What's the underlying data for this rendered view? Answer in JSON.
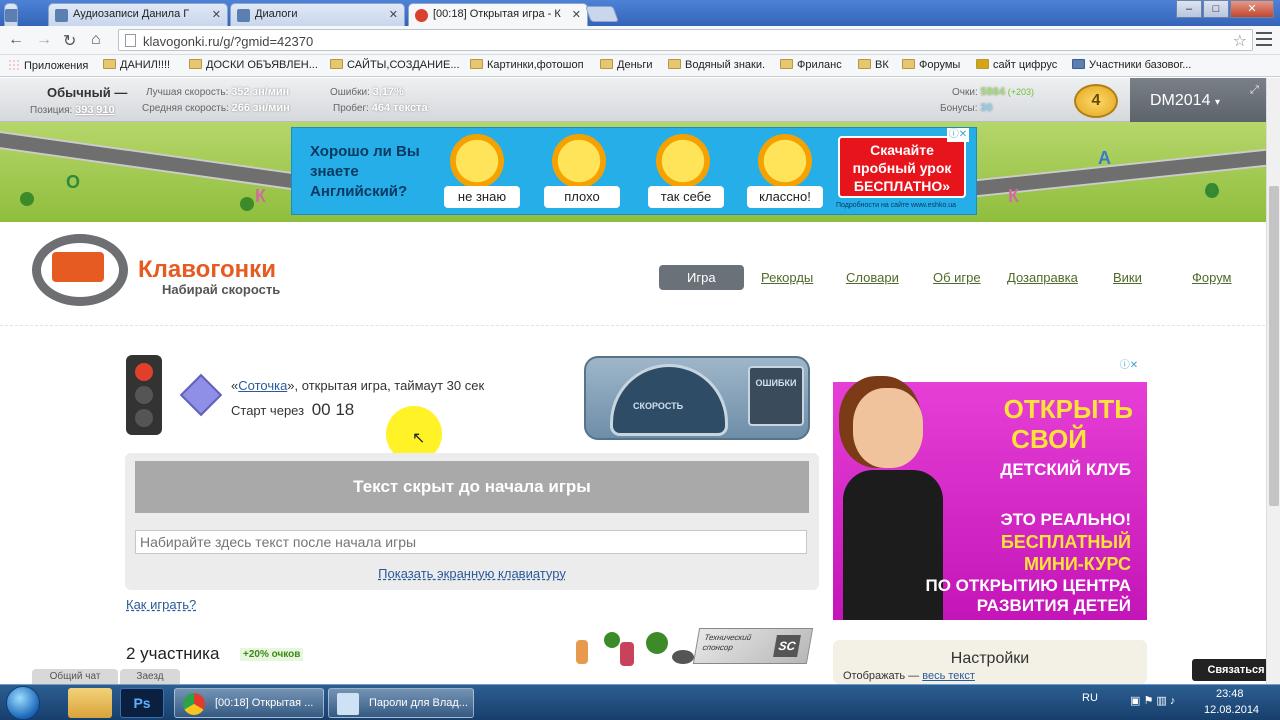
{
  "browser": {
    "tabs": [
      {
        "title": "Аудиозаписи Данила Г"
      },
      {
        "title": "Диалоги"
      },
      {
        "title": "[00:18] Открытая игра - К"
      }
    ],
    "url": "klavogonki.ru/g/?gmid=42370",
    "bookmarks": [
      "Приложения",
      "ДАНИЛ!!!!",
      "ДОСКИ ОБЪЯВЛЕН...",
      "САЙТЫ,СОЗДАНИЕ...",
      "Картинки,фотошоп",
      "Деньги",
      "Водяный знаки.",
      "Фриланс",
      "ВК",
      "Форумы",
      "сайт цифрус",
      "Участники базовог..."
    ]
  },
  "userbar": {
    "mode": "Обычный —",
    "position_label": "Позиция:",
    "position_value": "393",
    "position_total": "910",
    "best_speed_label": "Лучшая скорость:",
    "best_speed": "352 зн/мин",
    "avg_speed_label": "Средняя скорость:",
    "avg_speed": "266 зн/мин",
    "errors_label": "Ошибки:",
    "errors": "3,17%",
    "mileage_label": "Пробег:",
    "mileage": "464 текста",
    "points_label": "Очки:",
    "points": "5864",
    "points_delta": "(+203)",
    "bonus_label": "Бонусы:",
    "bonus": "30",
    "level": "4",
    "username": "DM2014"
  },
  "top_ad": {
    "question": "Хорошо ли Вы знаете Английский?",
    "options": [
      "не знаю",
      "плохо",
      "так себе",
      "классно!"
    ],
    "cta": "Скачайте пробный урок БЕСПЛАТНО»",
    "small": "Подробности на сайте www.eshko.ua"
  },
  "site": {
    "logo_title": "Клавогонки",
    "logo_sub": "Набирай скорость",
    "nav": [
      "Игра",
      "Рекорды",
      "Словари",
      "Об игре",
      "Дозаправка",
      "Вики",
      "Форум"
    ]
  },
  "game": {
    "game_link": "Соточка",
    "game_desc": ", открытая игра, таймаут 30 сек",
    "start_label": "Старт через",
    "timer": "00 18",
    "speed_label": "СКОРОСТЬ",
    "errors_label": "ОШИБКИ",
    "hidden_text": "Текст скрыт до начала игры",
    "input_placeholder": "Набирайте здесь текст после начала игры",
    "show_keyboard": "Показать экранную клавиатуру",
    "how_to_play": "Как играть?",
    "participants": "2 участника",
    "bonus_badge": "+20% очков",
    "sponsor_label": "Технический спонсор",
    "sponsor_logo": "SC"
  },
  "right_ad": {
    "lines": [
      "ОТКРЫТЬ",
      "СВОЙ",
      "ДЕТСКИЙ КЛУБ",
      "ЭТО РЕАЛЬНО!",
      "БЕСПЛАТНЫЙ",
      "МИНИ-КУРС",
      "ПО ОТКРЫТИЮ ЦЕНТРА",
      "РАЗВИТИЯ ДЕТЕЙ"
    ]
  },
  "settings": {
    "title": "Настройки",
    "show_label": "Отображать —",
    "show_link": "весь текст"
  },
  "chat": {
    "general": "Общий чат",
    "race": "Заезд",
    "connect": "Связаться"
  },
  "taskbar": {
    "tasks": [
      "[00:18] Открытая ...",
      "Пароли для Влад..."
    ],
    "lang": "RU",
    "time": "23:48",
    "date": "12.08.2014"
  }
}
